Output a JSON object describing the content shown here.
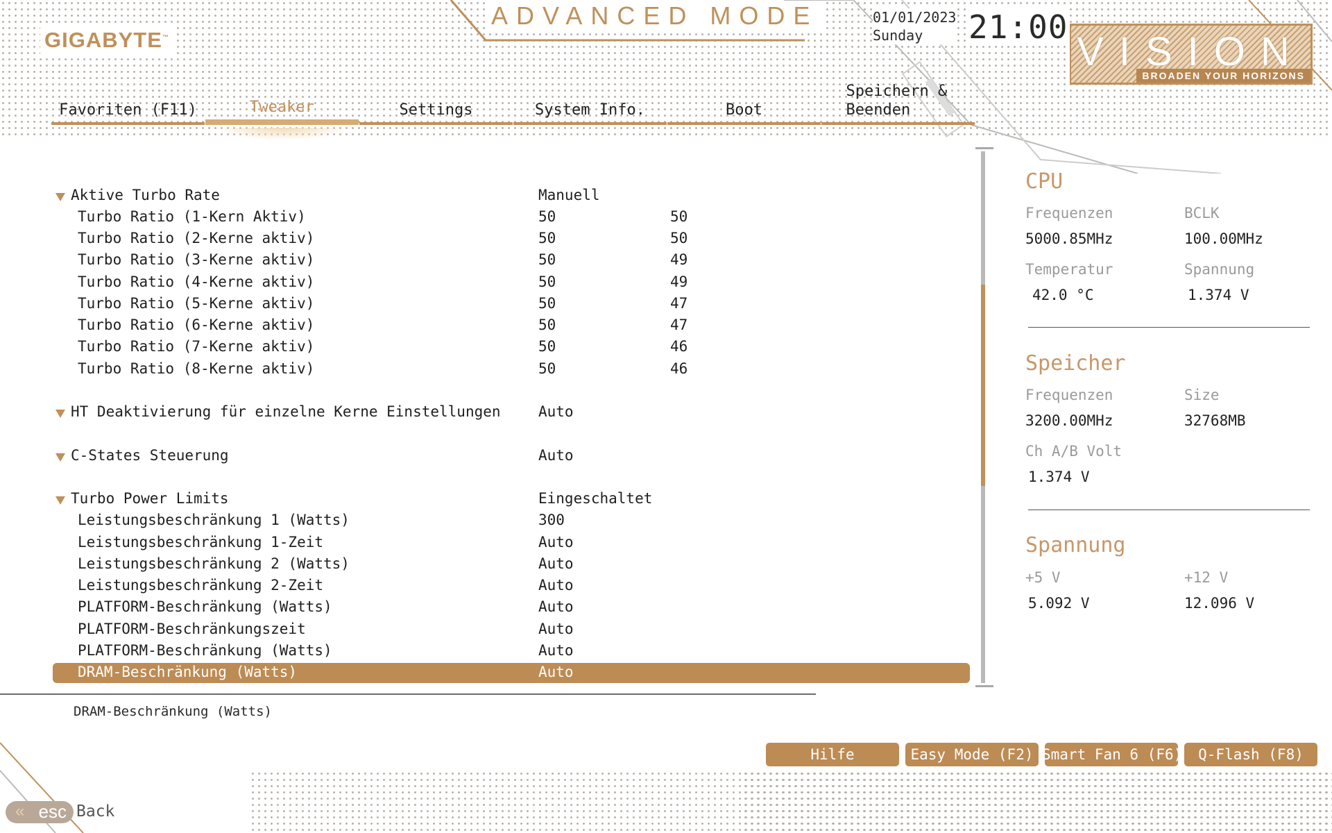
{
  "header": {
    "brand": "GIGABYTE",
    "brand_tm": "™",
    "mode_title": "ADVANCED MODE",
    "date": "01/01/2023",
    "weekday": "Sunday",
    "time": "21:00",
    "vision_word": "VISION",
    "vision_tagline": "BROADEN YOUR HORIZONS"
  },
  "tabs": [
    {
      "label": "Favoriten (F11)",
      "active": false
    },
    {
      "label": "Tweaker",
      "active": true
    },
    {
      "label": "Settings",
      "active": false
    },
    {
      "label": "System Info.",
      "active": false
    },
    {
      "label": "Boot",
      "active": false
    },
    {
      "label": "Speichern & Beenden",
      "active": false
    }
  ],
  "rows": [
    {
      "type": "head",
      "label": "Aktive Turbo Rate",
      "v1": "Manuell",
      "v2": ""
    },
    {
      "type": "sub",
      "label": "Turbo Ratio (1-Kern Aktiv)",
      "v1": "50",
      "v2": "50"
    },
    {
      "type": "sub",
      "label": "Turbo Ratio (2-Kerne aktiv)",
      "v1": "50",
      "v2": "50"
    },
    {
      "type": "sub",
      "label": "Turbo Ratio (3-Kerne aktiv)",
      "v1": "50",
      "v2": "49"
    },
    {
      "type": "sub",
      "label": "Turbo Ratio (4-Kerne aktiv)",
      "v1": "50",
      "v2": "49"
    },
    {
      "type": "sub",
      "label": "Turbo Ratio (5-Kerne aktiv)",
      "v1": "50",
      "v2": "47"
    },
    {
      "type": "sub",
      "label": "Turbo Ratio (6-Kerne aktiv)",
      "v1": "50",
      "v2": "47"
    },
    {
      "type": "sub",
      "label": "Turbo Ratio (7-Kerne aktiv)",
      "v1": "50",
      "v2": "46"
    },
    {
      "type": "sub",
      "label": "Turbo Ratio (8-Kerne aktiv)",
      "v1": "50",
      "v2": "46"
    },
    {
      "type": "head",
      "label": "HT Deaktivierung für einzelne Kerne Einstellungen",
      "v1": "Auto",
      "v2": ""
    },
    {
      "type": "head",
      "label": "C-States Steuerung",
      "v1": "Auto",
      "v2": ""
    },
    {
      "type": "head",
      "label": "Turbo Power Limits",
      "v1": "Eingeschaltet",
      "v2": ""
    },
    {
      "type": "sub",
      "label": "Leistungsbeschränkung 1 (Watts)",
      "v1": "300",
      "v2": ""
    },
    {
      "type": "sub",
      "label": "Leistungsbeschränkung 1-Zeit",
      "v1": "Auto",
      "v2": ""
    },
    {
      "type": "sub",
      "label": "Leistungsbeschränkung 2 (Watts)",
      "v1": "Auto",
      "v2": ""
    },
    {
      "type": "sub",
      "label": "Leistungsbeschränkung 2-Zeit",
      "v1": "Auto",
      "v2": ""
    },
    {
      "type": "sub",
      "label": "PLATFORM-Beschränkung (Watts)",
      "v1": "Auto",
      "v2": ""
    },
    {
      "type": "sub",
      "label": "PLATFORM-Beschränkungszeit",
      "v1": "Auto",
      "v2": ""
    },
    {
      "type": "sub",
      "label": "PLATFORM-Beschränkung (Watts)",
      "v1": "Auto",
      "v2": ""
    },
    {
      "type": "sub",
      "label": "DRAM-Beschränkung (Watts)",
      "v1": "Auto",
      "v2": "",
      "selected": true
    }
  ],
  "help_text": "DRAM-Beschränkung (Watts)",
  "sidebar": {
    "cpu": {
      "title": "CPU",
      "freq_label": "Frequenzen",
      "freq_value": "5000.85MHz",
      "bclk_label": "BCLK",
      "bclk_value": "100.00MHz",
      "temp_label": "Temperatur",
      "temp_value": "42.0 °C",
      "volt_label": "Spannung",
      "volt_value": "1.374 V"
    },
    "memory": {
      "title": "Speicher",
      "freq_label": "Frequenzen",
      "freq_value": "3200.00MHz",
      "size_label": "Size",
      "size_value": "32768MB",
      "chvolt_label": "Ch A/B Volt",
      "chvolt_value": "1.374 V"
    },
    "voltage": {
      "title": "Spannung",
      "v5_label": "+5 V",
      "v5_value": "5.092 V",
      "v12_label": "+12 V",
      "v12_value": "12.096 V"
    }
  },
  "buttons": {
    "help": "Hilfe",
    "easy_mode": "Easy Mode (F2)",
    "smart_fan": "Smart Fan 6 (F6)",
    "qflash": "Q-Flash (F8)"
  },
  "footer": {
    "esc_label": "esc",
    "back_label": "Back"
  },
  "colors": {
    "accent": "#c0905a",
    "selected_row": "#bd8b54",
    "scroll_thumb": "#c0905a"
  }
}
